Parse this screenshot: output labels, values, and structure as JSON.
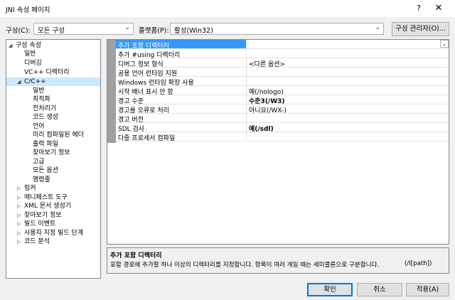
{
  "window": {
    "title": "JNI 속성 페이지",
    "help": "?",
    "close": "✕"
  },
  "config": {
    "label": "구성(C):",
    "value": "모든 구성"
  },
  "platform": {
    "label": "플랫폼(P):",
    "value": "활성(Win32)"
  },
  "config_manager_label": "구성 관리자(O)...",
  "tree": [
    {
      "label": "구성 속성",
      "expander": "◢"
    },
    {
      "label": "일반"
    },
    {
      "label": "디버깅"
    },
    {
      "label": "VC++ 디렉터리"
    },
    {
      "label": "C/C++",
      "expander": "◢"
    },
    {
      "label": "일반"
    },
    {
      "label": "최적화"
    },
    {
      "label": "전처리기"
    },
    {
      "label": "코드 생성"
    },
    {
      "label": "언어"
    },
    {
      "label": "미리 컴파일된 헤더"
    },
    {
      "label": "출력 파일"
    },
    {
      "label": "찾아보기 정보"
    },
    {
      "label": "고급"
    },
    {
      "label": "모든 옵션"
    },
    {
      "label": "명령줄"
    },
    {
      "label": "링커",
      "expander": "▷"
    },
    {
      "label": "매니페스트 도구",
      "expander": "▷"
    },
    {
      "label": "XML 문서 생성기",
      "expander": "▷"
    },
    {
      "label": "찾아보기 정보",
      "expander": "▷"
    },
    {
      "label": "빌드 이벤트",
      "expander": "▷"
    },
    {
      "label": "사용자 지정 빌드 단계",
      "expander": "▷"
    },
    {
      "label": "코드 분석",
      "expander": "▷"
    }
  ],
  "properties": [
    {
      "name": "추가 포함 디렉터리",
      "value": ""
    },
    {
      "name": "추가 #using 디렉터리",
      "value": ""
    },
    {
      "name": "디버그 정보 형식",
      "value": "<다른 옵션>"
    },
    {
      "name": "공용 언어 런타임 지원",
      "value": ""
    },
    {
      "name": "Windows 런타임 확장 사용",
      "value": ""
    },
    {
      "name": "시작 배너 표시 안 함",
      "value": "예(/nologo)"
    },
    {
      "name": "경고 수준",
      "value": "수준3(/W3)"
    },
    {
      "name": "경고를 오류로 처리",
      "value": "아니요(/WX-)"
    },
    {
      "name": "경고 버전",
      "value": ""
    },
    {
      "name": "SDL 검사",
      "value": "예(/sdl)"
    },
    {
      "name": "다중 프로세서 컴파일",
      "value": ""
    }
  ],
  "description": {
    "title": "추가 포함 디렉터리",
    "text": "포함 경로에 추가할 하나 이상의 디렉터리를 지정합니다. 항목이 여러 개일 때는 세미콜론으로 구분합니다.",
    "switch": "(/I[path])"
  },
  "buttons": {
    "ok": "확인",
    "cancel": "취소",
    "apply": "적용(A)"
  }
}
